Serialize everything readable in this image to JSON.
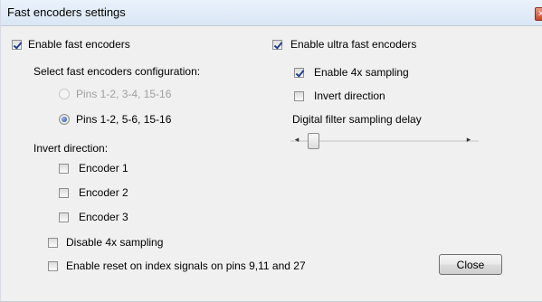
{
  "window": {
    "title": "Fast encoders settings"
  },
  "fast": {
    "enable_label": "Enable fast encoders",
    "enable_checked": true,
    "config_heading": "Select fast encoders configuration:",
    "options": [
      {
        "label": "Pins 1-2, 3-4, 15-16",
        "enabled": false,
        "selected": false
      },
      {
        "label": "Pins 1-2, 5-6, 15-16",
        "enabled": true,
        "selected": true
      }
    ],
    "invert_heading": "Invert direction:",
    "encoders": [
      "Encoder 1",
      "Encoder 2",
      "Encoder 3"
    ],
    "disable4x_label": "Disable 4x sampling",
    "reset_label": "Enable reset on index signals on pins 9,11 and 27"
  },
  "ultra": {
    "enable_label": "Enable ultra fast encoders",
    "enable_checked": true,
    "sampling_label": "Enable 4x sampling",
    "sampling_checked": true,
    "invert_label": "Invert direction",
    "invert_checked": false,
    "filter_label": "Digital filter sampling delay",
    "filter_value": 0
  },
  "buttons": {
    "close_label": "Close"
  },
  "icons": {
    "left": "◂",
    "right": "▸",
    "close": "✕"
  }
}
